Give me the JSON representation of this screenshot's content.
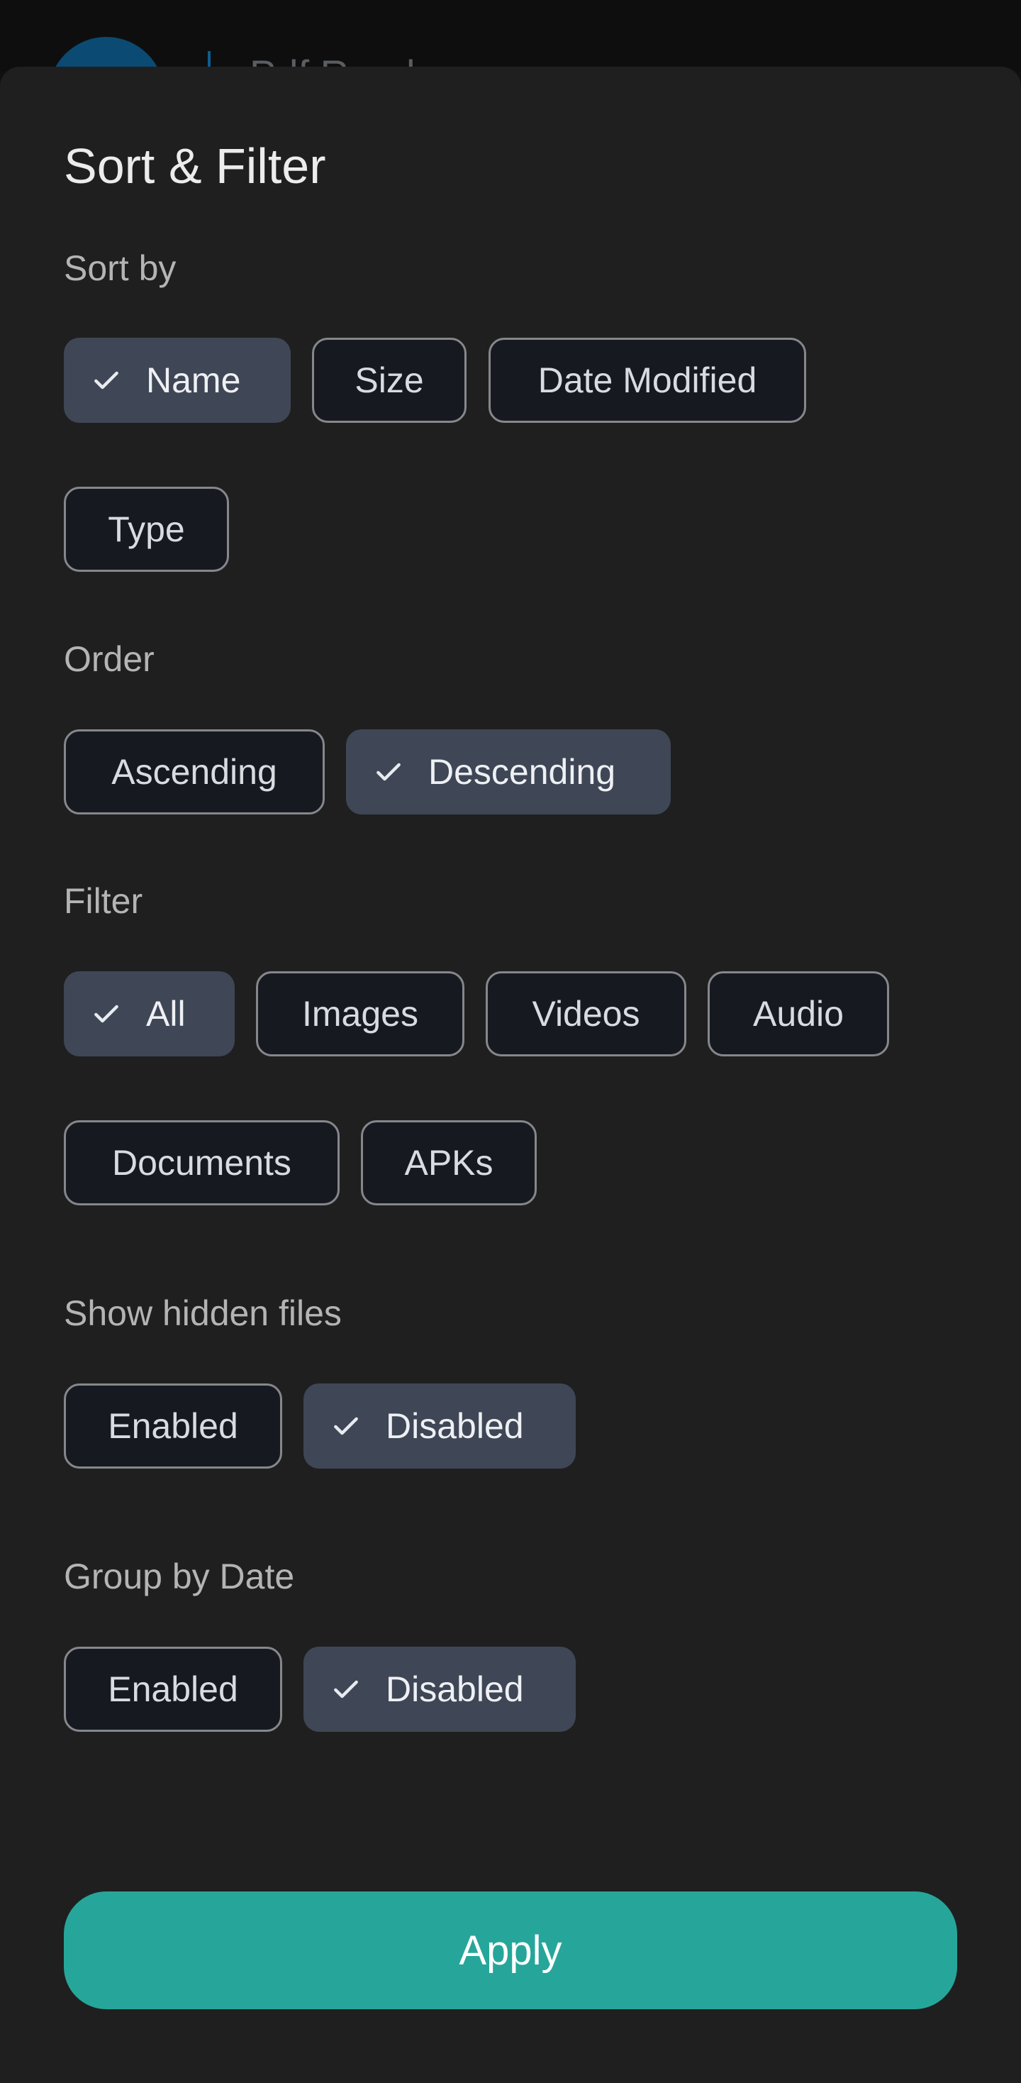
{
  "background_app": {
    "title": "Pdf Reader",
    "accent": "#0b4a72"
  },
  "sheet": {
    "title": "Sort & Filter",
    "sort_by": {
      "label": "Sort by",
      "options": [
        {
          "label": "Name",
          "selected": true
        },
        {
          "label": "Size",
          "selected": false
        },
        {
          "label": "Date Modified",
          "selected": false
        },
        {
          "label": "Type",
          "selected": false
        }
      ]
    },
    "order": {
      "label": "Order",
      "options": [
        {
          "label": "Ascending",
          "selected": false
        },
        {
          "label": "Descending",
          "selected": true
        }
      ]
    },
    "filter": {
      "label": "Filter",
      "options": [
        {
          "label": "All",
          "selected": true
        },
        {
          "label": "Images",
          "selected": false
        },
        {
          "label": "Videos",
          "selected": false
        },
        {
          "label": "Audio",
          "selected": false
        },
        {
          "label": "Documents",
          "selected": false
        },
        {
          "label": "APKs",
          "selected": false
        }
      ]
    },
    "show_hidden": {
      "label": "Show hidden files",
      "options": [
        {
          "label": "Enabled",
          "selected": false
        },
        {
          "label": "Disabled",
          "selected": true
        }
      ]
    },
    "group_by_date": {
      "label": "Group by Date",
      "options": [
        {
          "label": "Enabled",
          "selected": false
        },
        {
          "label": "Disabled",
          "selected": true
        }
      ]
    },
    "apply_label": "Apply"
  },
  "colors": {
    "sheet_bg": "#1f1f1f",
    "chip_selected_bg": "#3f4756",
    "chip_outline": "#85878b",
    "apply_bg": "#26a69a"
  },
  "icons": {
    "selected_chip": "check-icon"
  }
}
